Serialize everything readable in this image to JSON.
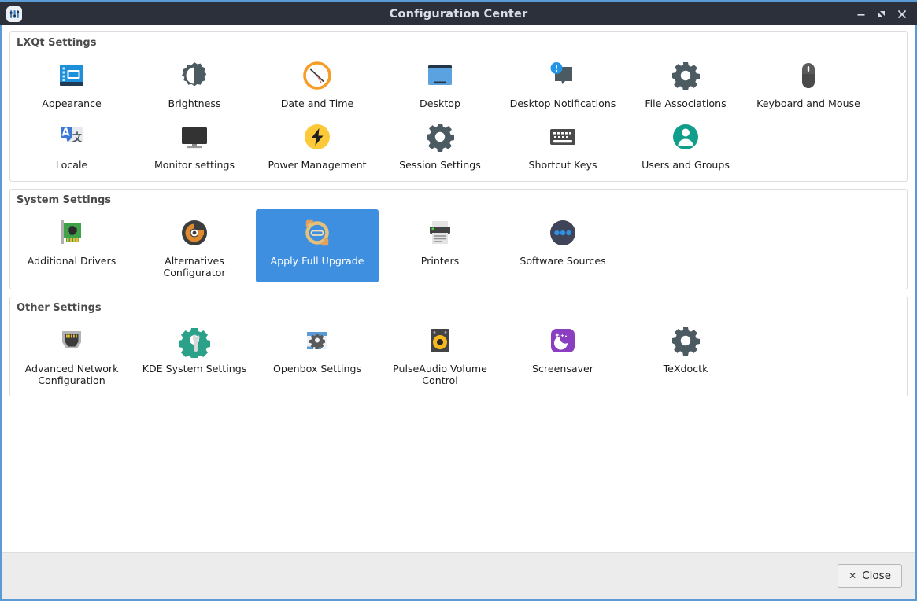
{
  "window": {
    "title": "Configuration Center",
    "app_icon": "config-center-icon",
    "buttons": {
      "minimize": "minimize-icon",
      "maximize": "maximize-icon",
      "close": "close-icon"
    },
    "accent_color": "#5b9bd5",
    "titlebar_color": "#2b303b",
    "selection_color": "#3f8fe0"
  },
  "groups": [
    {
      "title": "LXQt Settings",
      "items": [
        {
          "label": "Appearance",
          "icon": "appearance-icon",
          "selected": false
        },
        {
          "label": "Brightness",
          "icon": "brightness-icon",
          "selected": false
        },
        {
          "label": "Date and Time",
          "icon": "clock-icon",
          "selected": false
        },
        {
          "label": "Desktop",
          "icon": "desktop-icon",
          "selected": false
        },
        {
          "label": "Desktop Notifications",
          "icon": "notification-icon",
          "selected": false
        },
        {
          "label": "File Associations",
          "icon": "gear-icon",
          "selected": false
        },
        {
          "label": "Keyboard and Mouse",
          "icon": "mouse-icon",
          "selected": false
        },
        {
          "label": "Locale",
          "icon": "translate-icon",
          "selected": false
        },
        {
          "label": "Monitor settings",
          "icon": "monitor-icon",
          "selected": false
        },
        {
          "label": "Power Management",
          "icon": "power-bolt-icon",
          "selected": false
        },
        {
          "label": "Session Settings",
          "icon": "gear-icon",
          "selected": false
        },
        {
          "label": "Shortcut Keys",
          "icon": "keyboard-icon",
          "selected": false
        },
        {
          "label": "Users and Groups",
          "icon": "user-circle-icon",
          "selected": false
        }
      ]
    },
    {
      "title": "System Settings",
      "items": [
        {
          "label": "Additional Drivers",
          "icon": "pci-card-icon",
          "selected": false
        },
        {
          "label": "Alternatives Configurator",
          "icon": "alternatives-icon",
          "selected": false
        },
        {
          "label": "Apply Full Upgrade",
          "icon": "upgrade-refresh-icon",
          "selected": true
        },
        {
          "label": "Printers",
          "icon": "printer-icon",
          "selected": false
        },
        {
          "label": "Software Sources",
          "icon": "software-sources-icon",
          "selected": false
        }
      ]
    },
    {
      "title": "Other Settings",
      "items": [
        {
          "label": "Advanced Network Configuration",
          "icon": "ethernet-port-icon",
          "selected": false
        },
        {
          "label": "KDE System Settings",
          "icon": "kde-gear-wrench-icon",
          "selected": false
        },
        {
          "label": "Openbox Settings",
          "icon": "openbox-window-icon",
          "selected": false
        },
        {
          "label": "PulseAudio Volume Control",
          "icon": "speaker-icon",
          "selected": false
        },
        {
          "label": "Screensaver",
          "icon": "moon-stars-icon",
          "selected": false
        },
        {
          "label": "TeXdoctk",
          "icon": "gear-icon",
          "selected": false
        }
      ]
    }
  ],
  "footer": {
    "close_label": "Close",
    "close_glyph": "✕"
  }
}
